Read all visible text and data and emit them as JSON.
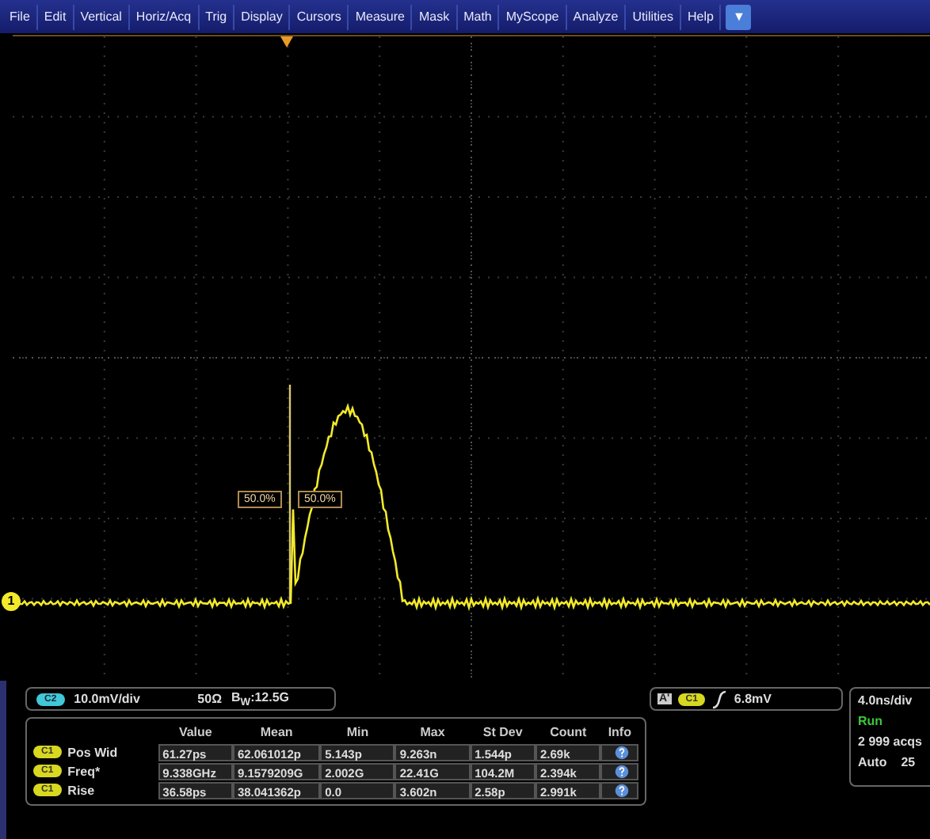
{
  "menu": [
    "File",
    "Edit",
    "Vertical",
    "Horiz/Acq",
    "Trig",
    "Display",
    "Cursors",
    "Measure",
    "Mask",
    "Math",
    "MyScope",
    "Analyze",
    "Utilities",
    "Help"
  ],
  "menu_dropdown": "▼",
  "ground_marker": "1",
  "cursor_labels": [
    "50.0%",
    "50.0%"
  ],
  "channel_readout": {
    "badge": "C2",
    "scale": "10.0mV/div",
    "impedance": "50Ω",
    "bandwidth": "B$_{W}$:12.5G"
  },
  "measurements": {
    "columns": [
      "Value",
      "Mean",
      "Min",
      "Max",
      "St Dev",
      "Count",
      "Info"
    ],
    "rows": [
      {
        "badge": "C1",
        "name": "Pos Wid",
        "cells": [
          "61.27ps",
          "62.061012p",
          "5.143p",
          "9.263n",
          "1.544p",
          "2.69k"
        ]
      },
      {
        "badge": "C1",
        "name": "Freq*",
        "cells": [
          "9.338GHz",
          "9.1579209G",
          "2.002G",
          "22.41G",
          "104.2M",
          "2.394k"
        ]
      },
      {
        "badge": "C1",
        "name": "Rise",
        "cells": [
          "36.58ps",
          "38.041362p",
          "0.0",
          "3.602n",
          "2.58p",
          "2.991k"
        ]
      }
    ]
  },
  "trigger": {
    "mode": "A'",
    "badge": "C1",
    "level": "6.8mV"
  },
  "timebase": {
    "scale": "4.0ns/div",
    "state": "Run",
    "acquisitions": "2 999 acqs",
    "mode": "Auto",
    "count": "25"
  }
}
